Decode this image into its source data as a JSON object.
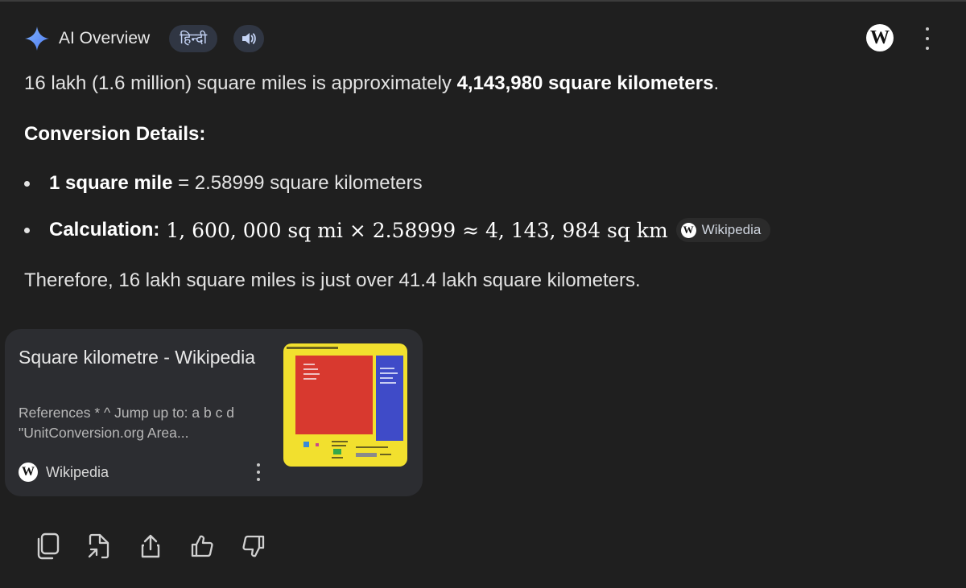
{
  "header": {
    "title": "AI Overview",
    "language_pill": "हिन्दी",
    "speaker_icon": "speaker-icon",
    "source_logo_letter": "W"
  },
  "answer": {
    "intro_prefix": "16 lakh (1.6 million) square miles is approximately ",
    "intro_bold": "4,143,980 square kilometers",
    "intro_suffix": ".",
    "details_heading": "Conversion Details:",
    "bullet1_bold": "1 square mile",
    "bullet1_rest": " = 2.58999 square kilometers",
    "bullet2_bold": "Calculation:",
    "bullet2_math": "1, 600, 000 sq mi × 2.58999 ≈ 4, 143, 984 sq km",
    "bullet2_source": "Wikipedia",
    "therefore": "Therefore, 16 lakh square miles is just over 41.4 lakh square kilometers."
  },
  "card": {
    "title": "Square kilometre - Wikipedia",
    "snippet": "References * ^ Jump up to: a b c d \"UnitConversion.org Area...",
    "source": "Wikipedia",
    "source_logo_letter": "W"
  },
  "actions": [
    "copy-icon",
    "open-in-new-icon",
    "share-icon",
    "thumbs-up-icon",
    "thumbs-down-icon"
  ],
  "colors": {
    "background": "#1f1f1f",
    "card": "#2c2d31",
    "pill": "#303643",
    "accent_blue": "#a8c7fa"
  }
}
